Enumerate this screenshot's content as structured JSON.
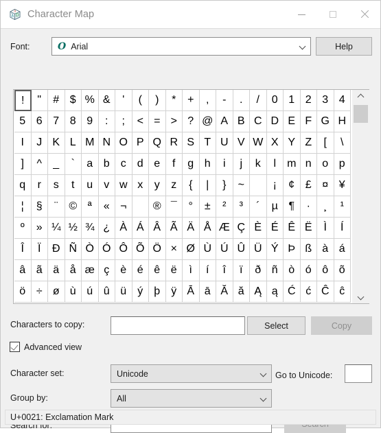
{
  "window": {
    "title": "Character Map",
    "app_icon": "character-map-icon",
    "controls": {
      "minimize": "minimize-icon",
      "maximize": "maximize-icon",
      "close": "close-icon"
    }
  },
  "font": {
    "label": "Font:",
    "selected": "Arial",
    "type_icon": "O",
    "help_label": "Help"
  },
  "grid": {
    "columns": 20,
    "selected_index": 0,
    "rows": [
      [
        "!",
        "\"",
        "#",
        "$",
        "%",
        "&",
        "'",
        "(",
        ")",
        "*",
        "+",
        ",",
        "-",
        ".",
        "/",
        "0",
        "1",
        "2",
        "3",
        "4"
      ],
      [
        "5",
        "6",
        "7",
        "8",
        "9",
        ":",
        ";",
        "<",
        "=",
        ">",
        "?",
        "@",
        "A",
        "B",
        "C",
        "D",
        "E",
        "F",
        "G",
        "H"
      ],
      [
        "I",
        "J",
        "K",
        "L",
        "M",
        "N",
        "O",
        "P",
        "Q",
        "R",
        "S",
        "T",
        "U",
        "V",
        "W",
        "X",
        "Y",
        "Z",
        "[",
        "\\"
      ],
      [
        "]",
        "^",
        "_",
        "`",
        "a",
        "b",
        "c",
        "d",
        "e",
        "f",
        "g",
        "h",
        "i",
        "j",
        "k",
        "l",
        "m",
        "n",
        "o",
        "p"
      ],
      [
        "q",
        "r",
        "s",
        "t",
        "u",
        "v",
        "w",
        "x",
        "y",
        "z",
        "{",
        "|",
        "}",
        "~",
        " ",
        "¡",
        "¢",
        "£",
        "¤",
        "¥"
      ],
      [
        "¦",
        "§",
        "¨",
        "©",
        "ª",
        "«",
        "¬",
        "­",
        "®",
        "¯",
        "°",
        "±",
        "²",
        "³",
        "´",
        "µ",
        "¶",
        "·",
        "¸",
        "¹"
      ],
      [
        "º",
        "»",
        "¼",
        "½",
        "¾",
        "¿",
        "À",
        "Á",
        "Â",
        "Ã",
        "Ä",
        "Å",
        "Æ",
        "Ç",
        "È",
        "É",
        "Ê",
        "Ë",
        "Ì",
        "Í"
      ],
      [
        "Î",
        "Ï",
        "Ð",
        "Ñ",
        "Ò",
        "Ó",
        "Ô",
        "Õ",
        "Ö",
        "×",
        "Ø",
        "Ù",
        "Ú",
        "Û",
        "Ü",
        "Ý",
        "Þ",
        "ß",
        "à",
        "á"
      ],
      [
        "â",
        "ã",
        "ä",
        "å",
        "æ",
        "ç",
        "è",
        "é",
        "ê",
        "ë",
        "ì",
        "í",
        "î",
        "ï",
        "ð",
        "ñ",
        "ò",
        "ó",
        "ô",
        "õ"
      ],
      [
        "ö",
        "÷",
        "ø",
        "ù",
        "ú",
        "û",
        "ü",
        "ý",
        "þ",
        "ÿ",
        "Ā",
        "ā",
        "Ă",
        "ă",
        "Ą",
        "ą",
        "Ć",
        "ć",
        "Ĉ",
        "ĉ"
      ]
    ],
    "scrollbar": {
      "up_icon": "chevron-up-icon",
      "down_icon": "chevron-down-icon"
    }
  },
  "copy_row": {
    "label": "Characters to copy:",
    "input_value": "",
    "select_label": "Select",
    "copy_label": "Copy",
    "copy_disabled": true
  },
  "advanced": {
    "label": "Advanced view",
    "checked": true
  },
  "charset": {
    "label": "Character set:",
    "selected": "Unicode"
  },
  "goto_unicode": {
    "label": "Go to Unicode:",
    "input_value": ""
  },
  "group_by": {
    "label": "Group by:",
    "selected": "All"
  },
  "search": {
    "label": "Search for:",
    "input_value": "",
    "button_label": "Search",
    "button_disabled": true
  },
  "status": {
    "text": "U+0021: Exclamation Mark"
  },
  "colors": {
    "window_bg": "#f0f0f0",
    "titlebar_bg": "#ffffff",
    "grid_bg": "#ffffff",
    "grid_line": "#d2d2d2",
    "button_bg": "#e1e1e1",
    "button_disabled_bg": "#cfcfcf",
    "combo_disabled_bg": "#e3e3e3",
    "selection_border": "#5c5c5c",
    "title_text": "#8a8a8a",
    "tt_icon": "#0a6e63"
  }
}
